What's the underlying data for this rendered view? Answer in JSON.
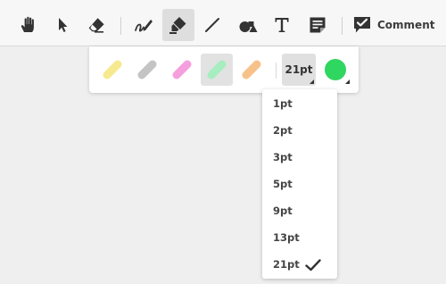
{
  "toolbar": {
    "tools": [
      {
        "name": "pan-tool",
        "icon": "hand-icon"
      },
      {
        "name": "select-tool",
        "icon": "cursor-arrow-icon"
      },
      {
        "name": "eraser-tool",
        "icon": "eraser-icon"
      },
      {
        "name": "freehand-tool",
        "icon": "pen-squiggle-icon"
      },
      {
        "name": "highlighter-tool",
        "icon": "highlighter-icon",
        "active": true
      },
      {
        "name": "line-tool",
        "icon": "line-icon"
      },
      {
        "name": "shape-tool",
        "icon": "shapes-icon"
      },
      {
        "name": "text-tool",
        "icon": "text-T-icon"
      },
      {
        "name": "note-tool",
        "icon": "note-icon"
      }
    ],
    "comment_label": "Comment"
  },
  "style_panel": {
    "swatches": [
      {
        "color": "#f7e98f",
        "selected": false
      },
      {
        "color": "#c4c4c4",
        "selected": false
      },
      {
        "color": "#f59fde",
        "selected": false
      },
      {
        "color": "#a6eebf",
        "selected": true
      },
      {
        "color": "#f7c28a",
        "selected": false
      }
    ],
    "size_label": "21pt",
    "current_color": "#2fd65f"
  },
  "size_menu": {
    "options": [
      "1pt",
      "2pt",
      "3pt",
      "5pt",
      "9pt",
      "13pt",
      "21pt"
    ],
    "selected": "21pt"
  }
}
